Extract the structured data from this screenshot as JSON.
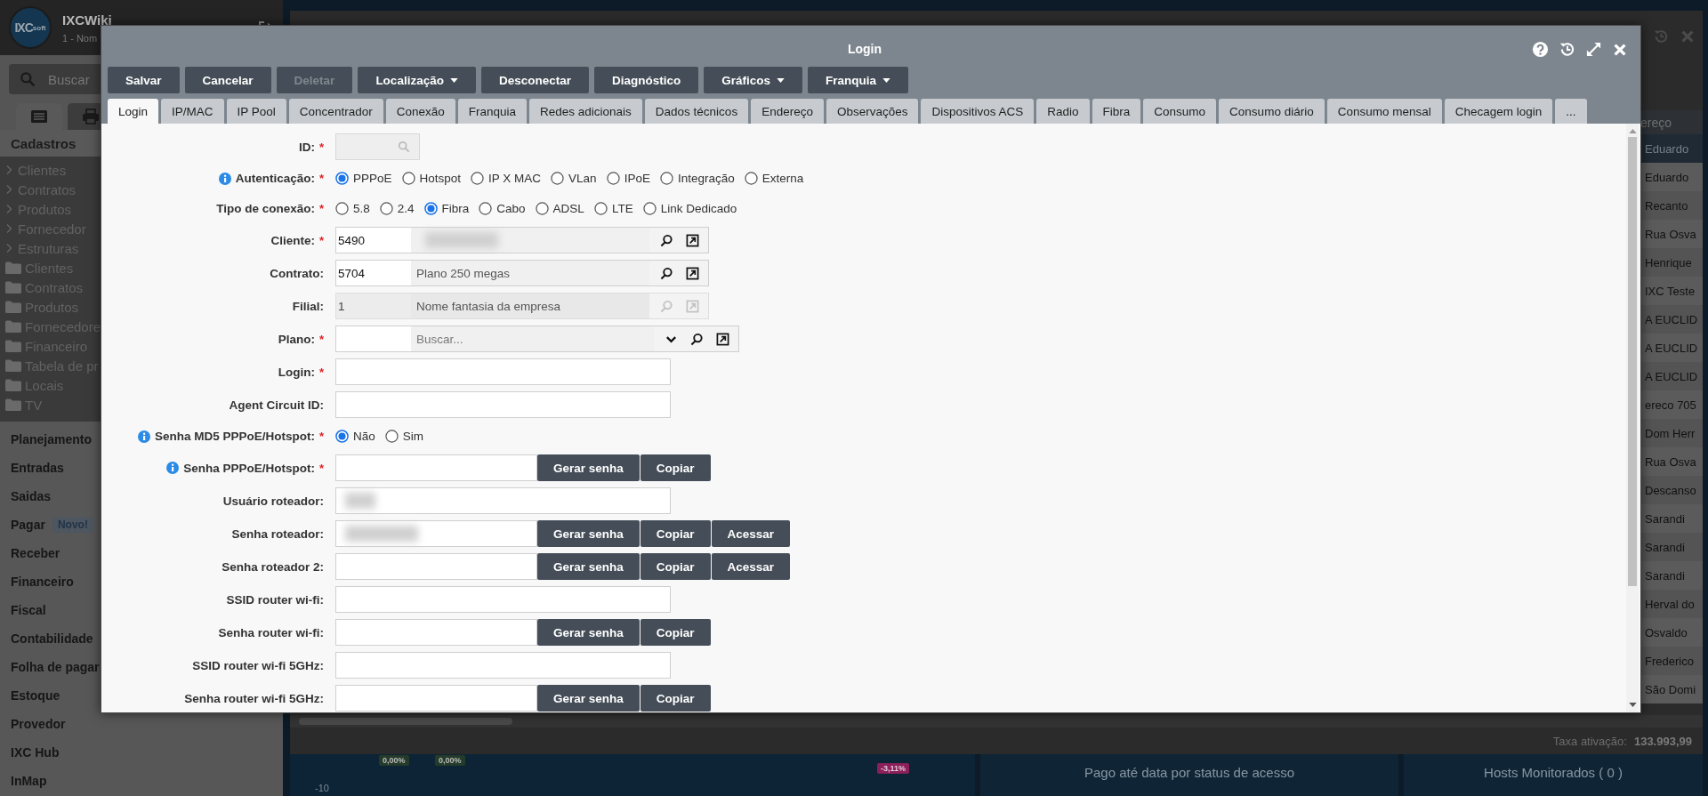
{
  "sidebar": {
    "logo": {
      "main": "IXC",
      "sub": "soft"
    },
    "app_name": "IXCWiki",
    "company": "1 - Nom",
    "search": {
      "placeholder": "Buscar"
    },
    "tabs": [
      {
        "kind": "list",
        "selected": true
      },
      {
        "kind": "print",
        "selected": false
      }
    ],
    "section": "Cadastros",
    "tree": [
      {
        "kind": "branch",
        "label": "Clientes"
      },
      {
        "kind": "branch",
        "label": "Contratos"
      },
      {
        "kind": "branch",
        "label": "Produtos"
      },
      {
        "kind": "branch",
        "label": "Fornecedor"
      },
      {
        "kind": "branch",
        "label": "Estruturas"
      },
      {
        "kind": "folder",
        "label": "Clientes"
      },
      {
        "kind": "folder",
        "label": "Contratos"
      },
      {
        "kind": "folder",
        "label": "Produtos"
      },
      {
        "kind": "folder",
        "label": "Fornecedore"
      },
      {
        "kind": "folder",
        "label": "Financeiro"
      },
      {
        "kind": "folder",
        "label": "Tabela de pr"
      },
      {
        "kind": "folder",
        "label": "Locais"
      },
      {
        "kind": "folder",
        "label": "TV"
      }
    ],
    "menu": [
      {
        "label": "Planejamento"
      },
      {
        "label": "Entradas"
      },
      {
        "label": "Saidas"
      },
      {
        "label": "Pagar",
        "badge": "Novo!"
      },
      {
        "label": "Receber"
      },
      {
        "label": "Financeiro"
      },
      {
        "label": "Fiscal"
      },
      {
        "label": "Contabilidade"
      },
      {
        "label": "Folha de pagar"
      },
      {
        "label": "Estoque"
      },
      {
        "label": "Provedor"
      },
      {
        "label": "IXC Hub"
      },
      {
        "label": "InMap"
      }
    ]
  },
  "background": {
    "table_header": "ereço",
    "rows": [
      {
        "text": "Eduardo",
        "selected": true
      },
      {
        "text": "Eduardo",
        "selected": false
      },
      {
        "text": "Recanto",
        "selected": false
      },
      {
        "text": "Rua Osva",
        "selected": false
      },
      {
        "text": "Henrique",
        "selected": false
      },
      {
        "text": "IXC Teste",
        "selected": false
      },
      {
        "text": "A EUCLID",
        "selected": false
      },
      {
        "text": "A EUCLID",
        "selected": false
      },
      {
        "text": "A EUCLID",
        "selected": false
      },
      {
        "text": "ereco 705",
        "selected": false
      },
      {
        "text": "Dom Herr",
        "selected": false
      },
      {
        "text": "Rua Osva",
        "selected": false
      },
      {
        "text": "Descanso",
        "selected": false
      },
      {
        "text": "Sarandi",
        "selected": false
      },
      {
        "text": "Sarandi",
        "selected": false
      },
      {
        "text": "Sarandi",
        "selected": false
      },
      {
        "text": "Herval do",
        "selected": false
      },
      {
        "text": "Osvaldo",
        "selected": false
      },
      {
        "text": "Frederico",
        "selected": false
      },
      {
        "text": "São Domi",
        "selected": false
      }
    ],
    "footer": {
      "label": "Taxa ativação:",
      "value": "133.993,99"
    },
    "chart_labels": [
      {
        "text": "0,00%",
        "kind": "neutral"
      },
      {
        "text": "0,00%",
        "kind": "neutral"
      },
      {
        "text": "-3,11%",
        "kind": "negative"
      }
    ],
    "axis_label": "-10",
    "panels": [
      "Pago até data por status de acesso",
      "Hosts Monitorados ( 0 )"
    ]
  },
  "modal": {
    "title": "Login",
    "toolbar": [
      {
        "label": "Salvar",
        "disabled": false
      },
      {
        "label": "Cancelar",
        "disabled": false
      },
      {
        "label": "Deletar",
        "disabled": true
      },
      {
        "label": "Localização",
        "disabled": false,
        "dropdown": true
      },
      {
        "label": "Desconectar",
        "disabled": false
      },
      {
        "label": "Diagnóstico",
        "disabled": false
      },
      {
        "label": "Gráficos",
        "disabled": false,
        "dropdown": true
      },
      {
        "label": "Franquia",
        "disabled": false,
        "dropdown": true
      }
    ],
    "tabs": [
      {
        "label": "Login",
        "selected": true
      },
      {
        "label": "IP/MAC",
        "selected": false
      },
      {
        "label": "IP Pool",
        "selected": false
      },
      {
        "label": "Concentrador",
        "selected": false
      },
      {
        "label": "Conexão",
        "selected": false
      },
      {
        "label": "Franquia",
        "selected": false
      },
      {
        "label": "Redes adicionais",
        "selected": false
      },
      {
        "label": "Dados técnicos",
        "selected": false
      },
      {
        "label": "Endereço",
        "selected": false
      },
      {
        "label": "Observações",
        "selected": false
      },
      {
        "label": "Dispositivos ACS",
        "selected": false
      },
      {
        "label": "Radio",
        "selected": false
      },
      {
        "label": "Fibra",
        "selected": false
      },
      {
        "label": "Consumo",
        "selected": false
      },
      {
        "label": "Consumo diário",
        "selected": false
      },
      {
        "label": "Consumo mensal",
        "selected": false
      },
      {
        "label": "Checagem login",
        "selected": false
      },
      {
        "label": "...",
        "selected": false
      }
    ],
    "form": {
      "rows": [
        {
          "kind": "search",
          "label": "ID:",
          "marker": "*",
          "disabled": true
        },
        {
          "kind": "radio",
          "label": "Autenticação:",
          "marker": "*",
          "info": true,
          "options": [
            {
              "label": "PPPoE",
              "selected": true
            },
            {
              "label": "Hotspot",
              "selected": false
            },
            {
              "label": "IP X MAC",
              "selected": false
            },
            {
              "label": "VLan",
              "selected": false
            },
            {
              "label": "IPoE",
              "selected": false
            },
            {
              "label": "Integração",
              "selected": false
            },
            {
              "label": "Externa",
              "selected": false
            }
          ]
        },
        {
          "kind": "radio",
          "label": "Tipo de conexão:",
          "marker": "*",
          "options": [
            {
              "label": "5.8",
              "selected": false
            },
            {
              "label": "2.4",
              "selected": false
            },
            {
              "label": "Fibra",
              "selected": true
            },
            {
              "label": "Cabo",
              "selected": false
            },
            {
              "label": "ADSL",
              "selected": false
            },
            {
              "label": "LTE",
              "selected": false
            },
            {
              "label": "Link Dedicado",
              "selected": false
            }
          ]
        },
        {
          "kind": "lookup",
          "label": "Cliente:",
          "marker": "*",
          "code": "5490",
          "redacted": true,
          "disabled": false
        },
        {
          "kind": "lookup",
          "label": "Contrato:",
          "code": "5704",
          "description": "Plano 250 megas",
          "disabled": false
        },
        {
          "kind": "lookup",
          "label": "Filial:",
          "code": "1",
          "description": "Nome fantasia da empresa",
          "disabled": true
        },
        {
          "kind": "lookup",
          "label": "Plano:",
          "marker": "*",
          "placeholder": "Buscar...",
          "disabled": false,
          "dropdown": true
        },
        {
          "kind": "text",
          "label": "Login:",
          "marker": "*"
        },
        {
          "kind": "text",
          "label": "Agent Circuit ID:"
        },
        {
          "kind": "radio",
          "label": "Senha MD5 PPPoE/Hotspot:",
          "marker": "*",
          "info": true,
          "options": [
            {
              "label": "Não",
              "selected": true
            },
            {
              "label": "Sim",
              "selected": false
            }
          ]
        },
        {
          "kind": "password",
          "label": "Senha PPPoE/Hotspot:",
          "marker": "*",
          "info": true,
          "buttons": [
            "Gerar senha",
            "Copiar"
          ]
        },
        {
          "kind": "text",
          "label": "Usuário roteador:",
          "redacted": true
        },
        {
          "kind": "password",
          "label": "Senha roteador:",
          "redacted": true,
          "buttons": [
            "Gerar senha",
            "Copiar",
            "Acessar"
          ]
        },
        {
          "kind": "password",
          "label": "Senha roteador 2:",
          "buttons": [
            "Gerar senha",
            "Copiar",
            "Acessar"
          ]
        },
        {
          "kind": "text",
          "label": "SSID router wi-fi:"
        },
        {
          "kind": "password",
          "label": "Senha router wi-fi:",
          "buttons": [
            "Gerar senha",
            "Copiar"
          ]
        },
        {
          "kind": "text",
          "label": "SSID router wi-fi 5GHz:"
        },
        {
          "kind": "password",
          "label": "Senha router wi-fi 5GHz:",
          "buttons": [
            "Gerar senha",
            "Copiar"
          ]
        }
      ]
    }
  }
}
